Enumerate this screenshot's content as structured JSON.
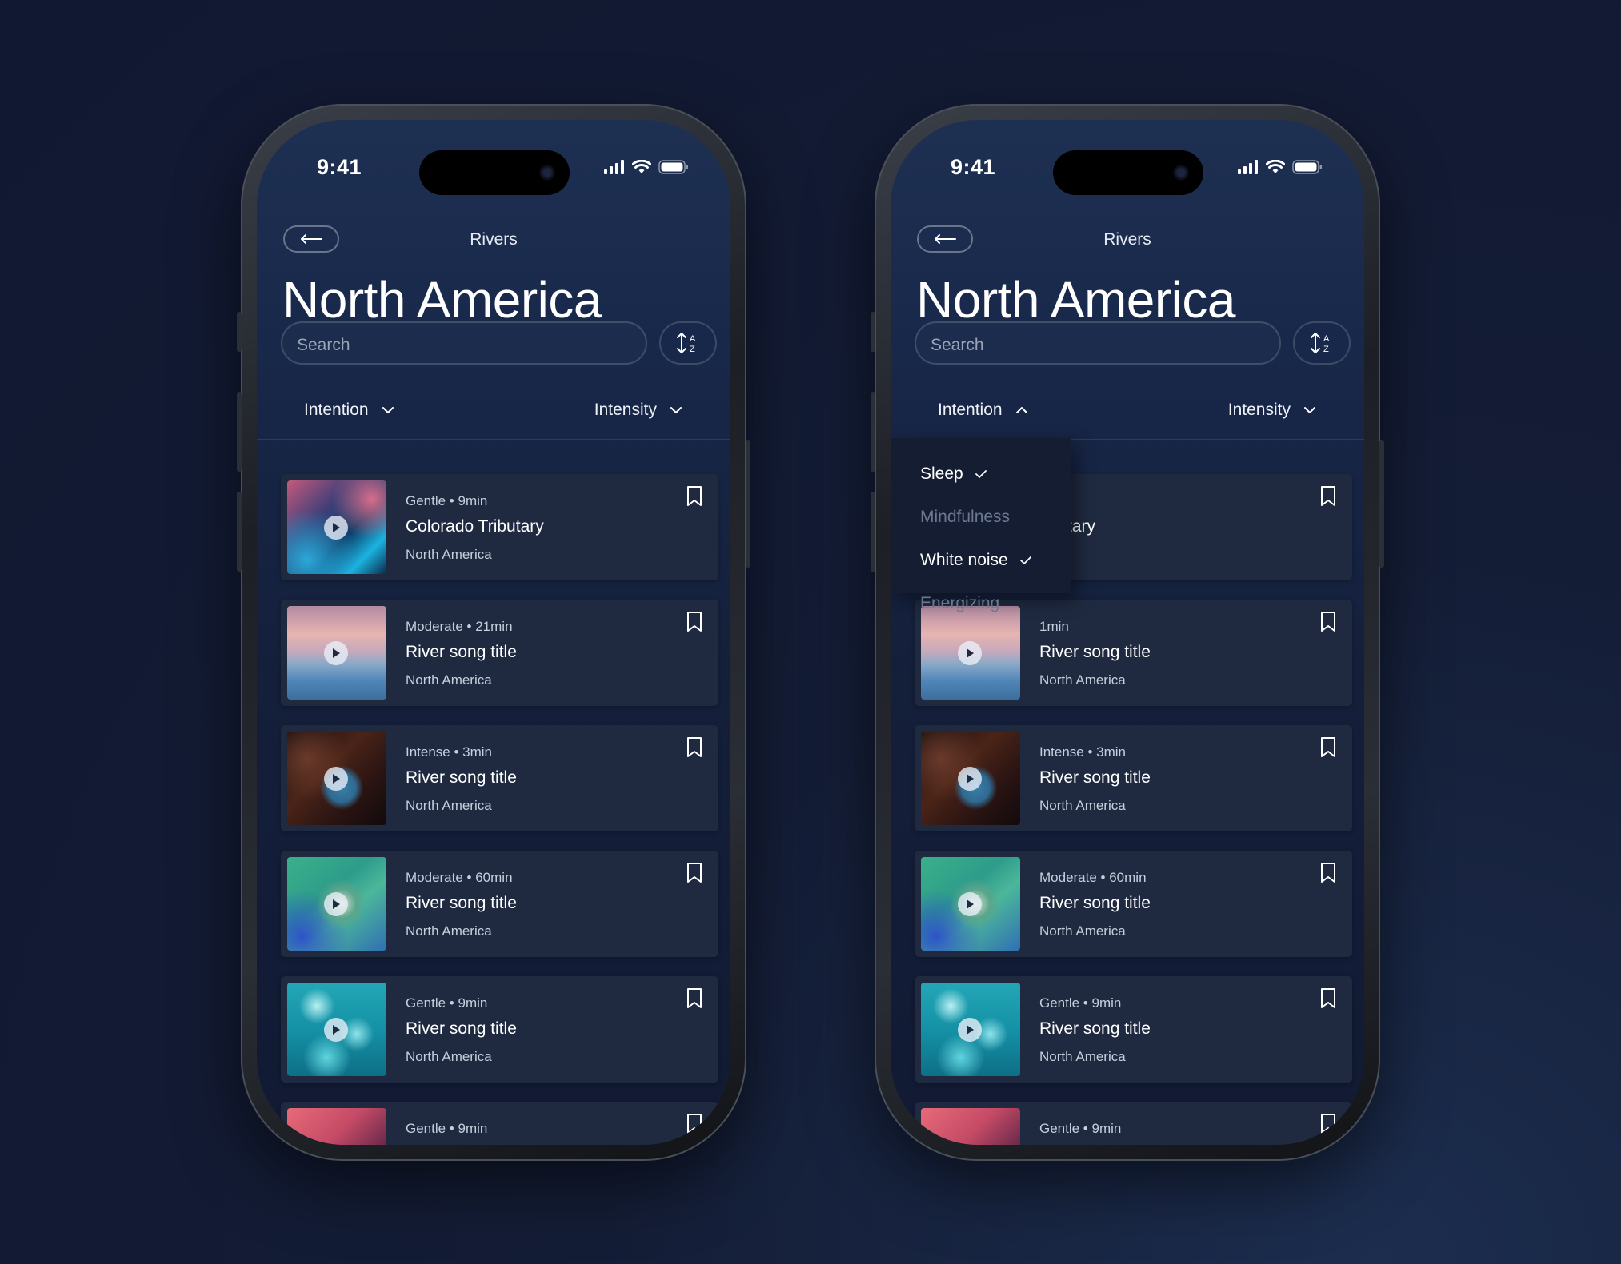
{
  "phones": [
    {
      "status": {
        "time": "9:41"
      },
      "nav": {
        "title": "Rivers"
      },
      "page_title": "North America",
      "search": {
        "placeholder": "Search"
      },
      "filters": {
        "intention": {
          "label": "Intention",
          "open": false
        },
        "intensity": {
          "label": "Intensity",
          "open": false
        }
      },
      "tracks": [
        {
          "meta": "Gentle • 9min",
          "title": "Colorado Tributary",
          "region": "North America"
        },
        {
          "meta": "Moderate • 21min",
          "title": "River song title",
          "region": "North America"
        },
        {
          "meta": "Intense • 3min",
          "title": "River song title",
          "region": "North America"
        },
        {
          "meta": "Moderate • 60min",
          "title": "River song title",
          "region": "North America"
        },
        {
          "meta": "Gentle • 9min",
          "title": "River song title",
          "region": "North America"
        },
        {
          "meta": "Gentle • 9min",
          "title": "",
          "region": ""
        }
      ]
    },
    {
      "status": {
        "time": "9:41"
      },
      "nav": {
        "title": "Rivers"
      },
      "page_title": "North America",
      "search": {
        "placeholder": "Search"
      },
      "filters": {
        "intention": {
          "label": "Intention",
          "open": true
        },
        "intensity": {
          "label": "Intensity",
          "open": false
        }
      },
      "intention_dropdown": [
        {
          "label": "Sleep",
          "selected": true
        },
        {
          "label": "Mindfulness",
          "selected": false
        },
        {
          "label": "White noise",
          "selected": true
        },
        {
          "label": "Energizing",
          "selected": false
        }
      ],
      "tracks": [
        {
          "meta": "n",
          "title": "ributary",
          "region": "a"
        },
        {
          "meta": "1min",
          "title": "River song title",
          "region": "North America"
        },
        {
          "meta": "Intense • 3min",
          "title": "River song title",
          "region": "North America"
        },
        {
          "meta": "Moderate • 60min",
          "title": "River song title",
          "region": "North America"
        },
        {
          "meta": "Gentle • 9min",
          "title": "River song title",
          "region": "North America"
        },
        {
          "meta": "Gentle • 9min",
          "title": "",
          "region": ""
        }
      ]
    }
  ],
  "icons": {
    "back": "arrow-left-icon",
    "sort": "sort-az-icon",
    "chevron_down": "chevron-down-icon",
    "chevron_up": "chevron-up-icon",
    "bookmark": "bookmark-icon",
    "play": "play-icon",
    "check": "check-icon",
    "signal": "signal-icon",
    "wifi": "wifi-icon",
    "battery": "battery-icon"
  },
  "colors": {
    "background": "#111831",
    "card": "#1f2a40",
    "dropdown": "#151d33",
    "text_primary": "#ffffff",
    "text_secondary": "#c5cfdd",
    "text_disabled": "#6c7891"
  }
}
